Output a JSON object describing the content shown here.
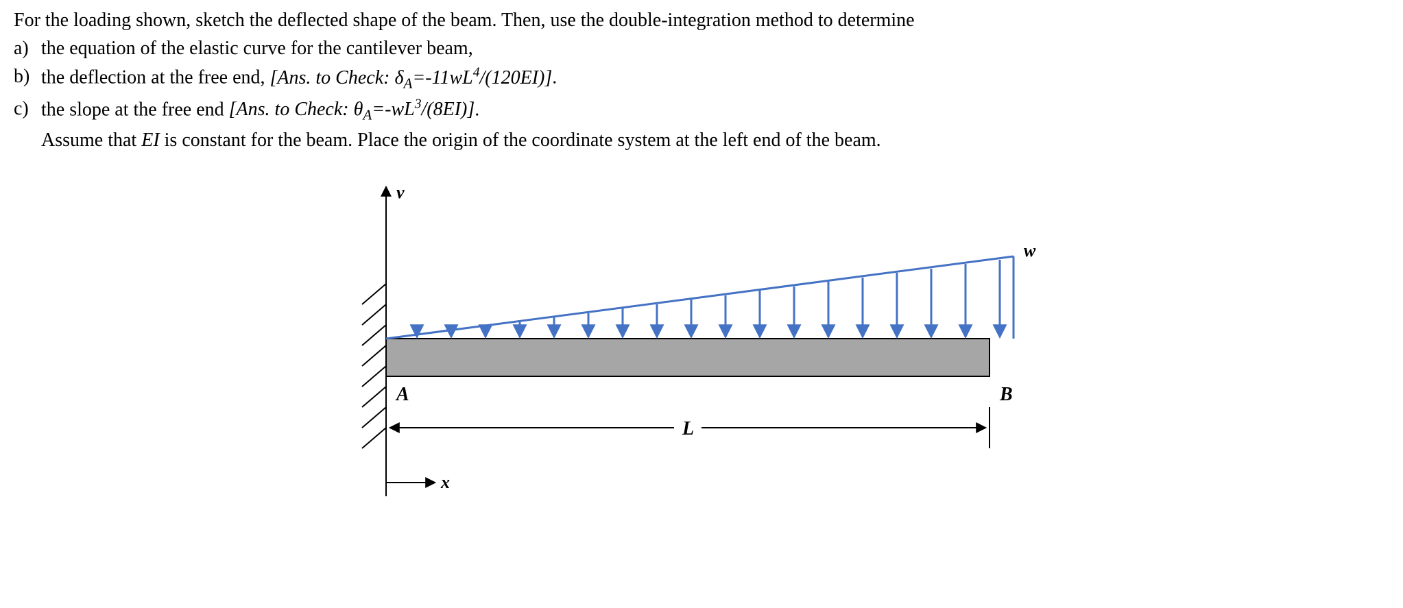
{
  "intro": "For the loading shown, sketch the deflected shape of the beam. Then, use the double-integration method to determine",
  "parts": {
    "a": {
      "label": "a)",
      "text": "the equation of the elastic curve for the cantilever beam,"
    },
    "b": {
      "label": "b)",
      "text_pre": "the deflection at the free end, ",
      "ans_label": "[Ans. to Check: ",
      "sym": "δ",
      "sub": "A",
      "eq": "=-11wL",
      "exp": "4",
      "eq2": "/(120EI)]",
      "dot": "."
    },
    "c": {
      "label": "c)",
      "text_pre": "the slope at the free end ",
      "ans_label": "[Ans. to Check: ",
      "sym": "θ",
      "sub": "A",
      "eq": "=-wL",
      "exp": "3",
      "eq2": "/(8EI)]",
      "dot": "."
    },
    "assume_pre": "Assume that ",
    "EI": "EI",
    "assume_post": " is constant for the beam. Place the origin of the coordinate system at the left end of the beam."
  },
  "diagram": {
    "v_label": "v",
    "x_label": "x",
    "w_label": "w",
    "A_label": "A",
    "B_label": "B",
    "L_label": "L"
  }
}
